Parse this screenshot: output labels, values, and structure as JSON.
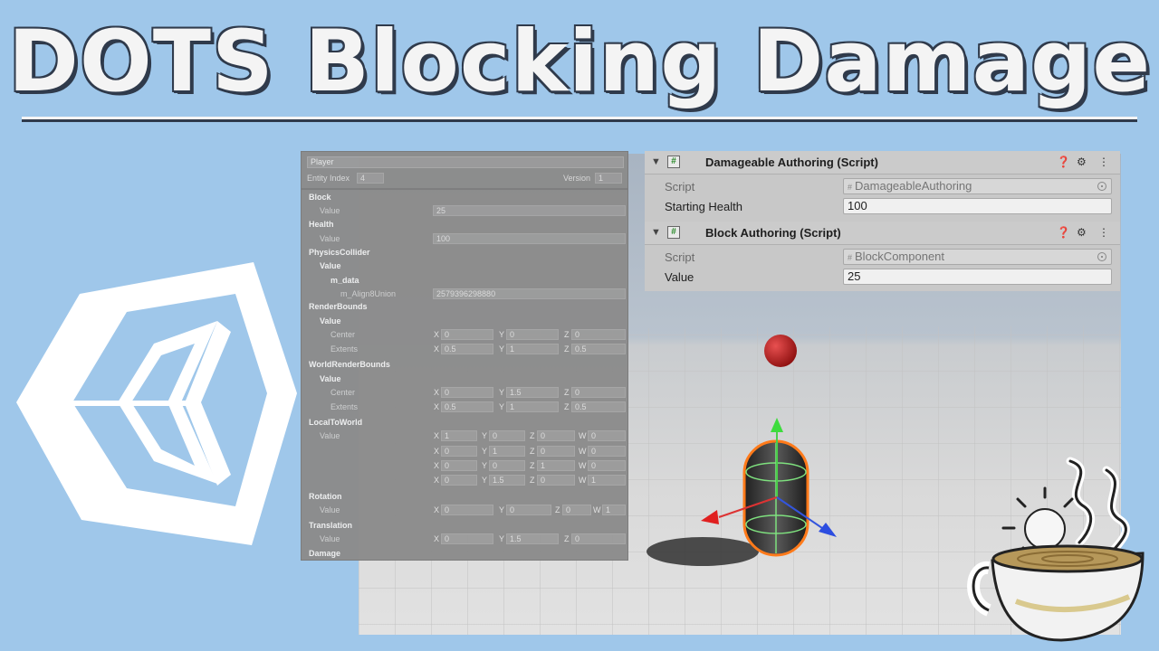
{
  "title": "DOTS Blocking Damage",
  "entity_debugger": {
    "entity_name": "Player",
    "entity_index_label": "Entity Index",
    "entity_index_value": "4",
    "version_label": "Version",
    "version_value": "1",
    "components": {
      "block": {
        "name": "Block",
        "value_label": "Value",
        "value": "25"
      },
      "health": {
        "name": "Health",
        "value_label": "Value",
        "value": "100"
      },
      "physics_collider": {
        "name": "PhysicsCollider",
        "value_label": "Value",
        "m_data_label": "m_data",
        "union_label": "m_Align8Union",
        "union_value": "2579396298880"
      },
      "render_bounds": {
        "name": "RenderBounds",
        "value_label": "Value",
        "center_label": "Center",
        "center": [
          "0",
          "0",
          "0"
        ],
        "extents_label": "Extents",
        "extents": [
          "0.5",
          "1",
          "0.5"
        ]
      },
      "world_render_bounds": {
        "name": "WorldRenderBounds",
        "value_label": "Value",
        "center_label": "Center",
        "center": [
          "0",
          "1.5",
          "0"
        ],
        "extents_label": "Extents",
        "extents": [
          "0.5",
          "1",
          "0.5"
        ]
      },
      "local_to_world": {
        "name": "LocalToWorld",
        "value_label": "Value",
        "rows": [
          [
            "1",
            "0",
            "0",
            "0"
          ],
          [
            "0",
            "1",
            "0",
            "0"
          ],
          [
            "0",
            "0",
            "1",
            "0"
          ],
          [
            "0",
            "1.5",
            "0",
            "1"
          ]
        ]
      },
      "rotation": {
        "name": "Rotation",
        "value_label": "Value",
        "values": [
          "0",
          "0",
          "0",
          "1"
        ]
      },
      "translation": {
        "name": "Translation",
        "value_label": "Value",
        "values": [
          "0",
          "1.5",
          "0"
        ]
      },
      "damage": {
        "name": "Damage"
      }
    },
    "axis_labels": {
      "x": "X",
      "y": "Y",
      "z": "Z",
      "w": "W"
    }
  },
  "inspector": {
    "damageable": {
      "name": "Damageable Authoring (Script)",
      "script_label": "Script",
      "script_value": "DamageableAuthoring",
      "field_label": "Starting Health",
      "field_value": "100"
    },
    "block": {
      "name": "Block Authoring (Script)",
      "script_label": "Script",
      "script_value": "BlockComponent",
      "field_label": "Value",
      "field_value": "25"
    },
    "icons": [
      "help-icon",
      "settings-sliders-icon",
      "kebab-menu-icon"
    ]
  },
  "colors": {
    "background": "#9fc7ea",
    "title_fill": "#f4f4f4",
    "title_outline": "#2f3a4b",
    "selection_outline": "#ff7a1a",
    "red_sphere": "#c81e1e"
  }
}
